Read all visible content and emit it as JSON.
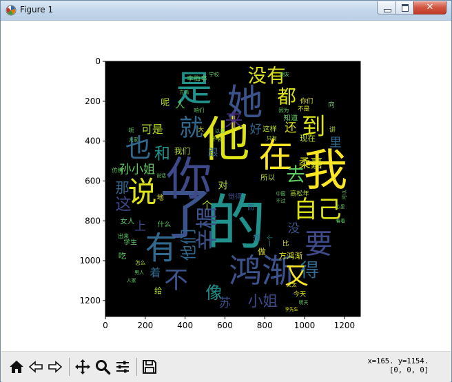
{
  "window": {
    "title": "Figure 1",
    "close_glyph": "✕"
  },
  "toolbar": {
    "items": [
      {
        "name": "home-icon"
      },
      {
        "name": "back-icon"
      },
      {
        "name": "forward-icon"
      },
      {
        "name": "pan-icon"
      },
      {
        "name": "zoom-icon"
      },
      {
        "name": "configure-subplots-icon"
      },
      {
        "name": "save-icon"
      }
    ],
    "coords_line1": "x=165. y=1154.",
    "coords_line2": "[0, 0, 0]"
  },
  "chart_data": {
    "type": "wordcloud",
    "xticks": [
      "0",
      "200",
      "400",
      "600",
      "800",
      "1000",
      "1200"
    ],
    "yticks": [
      "0",
      "200",
      "400",
      "600",
      "800",
      "1000",
      "1200"
    ],
    "xlim": [
      0,
      1280
    ],
    "ylim": [
      1280,
      0
    ],
    "words": [
      {
        "text": "的",
        "x": 655,
        "y": 815,
        "size": 300,
        "color": "#21918c",
        "rot": 0
      },
      {
        "text": "他",
        "x": 605,
        "y": 395,
        "size": 240,
        "color": "#dde318",
        "rot": 0
      },
      {
        "text": "了",
        "x": 400,
        "y": 770,
        "size": 280,
        "color": "#3b528b",
        "rot": 0
      },
      {
        "text": "你",
        "x": 420,
        "y": 590,
        "size": 230,
        "color": "#3e4989",
        "rot": 0
      },
      {
        "text": "我",
        "x": 1105,
        "y": 545,
        "size": 220,
        "color": "#fde725",
        "rot": 0
      },
      {
        "text": "在",
        "x": 855,
        "y": 470,
        "size": 170,
        "color": "#fde725",
        "rot": 0
      },
      {
        "text": "是",
        "x": 445,
        "y": 140,
        "size": 180,
        "color": "#21918c",
        "rot": 0
      },
      {
        "text": "她",
        "x": 700,
        "y": 210,
        "size": 180,
        "color": "#3b528b",
        "rot": 0
      },
      {
        "text": "鸿渐",
        "x": 785,
        "y": 1055,
        "size": 165,
        "color": "#3b528b",
        "rot": 0
      },
      {
        "text": "说",
        "x": 185,
        "y": 655,
        "size": 145,
        "color": "#dde318",
        "rot": 0
      },
      {
        "text": "有",
        "x": 280,
        "y": 935,
        "size": 160,
        "color": "#31688e",
        "rot": 0
      },
      {
        "text": "辛楣",
        "x": 510,
        "y": 840,
        "size": 110,
        "color": "#3b528b",
        "rot": -90
      },
      {
        "text": "也",
        "x": 165,
        "y": 435,
        "size": 130,
        "color": "#31688e",
        "rot": 0
      },
      {
        "text": "就",
        "x": 430,
        "y": 335,
        "size": 120,
        "color": "#31688e",
        "rot": 0
      },
      {
        "text": "自己",
        "x": 1065,
        "y": 745,
        "size": 120,
        "color": "#dde318",
        "rot": 0
      },
      {
        "text": "要",
        "x": 1070,
        "y": 915,
        "size": 140,
        "color": "#3e4989",
        "rot": 0
      },
      {
        "text": "又",
        "x": 960,
        "y": 1080,
        "size": 120,
        "color": "#fde725",
        "rot": 0
      },
      {
        "text": "没有",
        "x": 810,
        "y": 75,
        "size": 95,
        "color": "#dde318",
        "rot": 0
      },
      {
        "text": "都",
        "x": 910,
        "y": 180,
        "size": 95,
        "color": "#dde318",
        "rot": 0
      },
      {
        "text": "到",
        "x": 1045,
        "y": 330,
        "size": 120,
        "color": "#dde318",
        "rot": 0
      },
      {
        "text": "去",
        "x": 955,
        "y": 570,
        "size": 95,
        "color": "#5ec962",
        "rot": 0
      },
      {
        "text": "不",
        "x": 355,
        "y": 1100,
        "size": 120,
        "color": "#3b528b",
        "rot": 0
      },
      {
        "text": "他们",
        "x": 420,
        "y": 920,
        "size": 80,
        "color": "#31688e",
        "rot": -90
      },
      {
        "text": "小姐",
        "x": 790,
        "y": 1205,
        "size": 75,
        "color": "#3e4989",
        "rot": 0
      },
      {
        "text": "像",
        "x": 545,
        "y": 1160,
        "size": 85,
        "color": "#21918c",
        "rot": 0
      },
      {
        "text": "得",
        "x": 1025,
        "y": 1050,
        "size": 95,
        "color": "#31688e",
        "rot": 0
      },
      {
        "text": "来",
        "x": 645,
        "y": 300,
        "size": 90,
        "color": "#472c7a",
        "rot": 0
      },
      {
        "text": "和",
        "x": 285,
        "y": 465,
        "size": 80,
        "color": "#21918c",
        "rot": 0
      },
      {
        "text": "这",
        "x": 90,
        "y": 720,
        "size": 80,
        "color": "#3e4989",
        "rot": 0
      },
      {
        "text": "那",
        "x": 85,
        "y": 635,
        "size": 70,
        "color": "#31688e",
        "rot": 0
      },
      {
        "text": "孙小姐",
        "x": 160,
        "y": 545,
        "size": 60,
        "color": "#5ec962",
        "rot": 0
      },
      {
        "text": "可是",
        "x": 235,
        "y": 340,
        "size": 55,
        "color": "#b5de2b",
        "rot": 0
      },
      {
        "text": "人",
        "x": 375,
        "y": 220,
        "size": 50,
        "color": "#5ec962",
        "rot": 0
      },
      {
        "text": "柔嘉",
        "x": 1030,
        "y": 515,
        "size": 60,
        "color": "#dde318",
        "rot": 0
      },
      {
        "text": "里",
        "x": 1155,
        "y": 410,
        "size": 60,
        "color": "#31688e",
        "rot": 0
      },
      {
        "text": "还",
        "x": 930,
        "y": 335,
        "size": 60,
        "color": "#dde318",
        "rot": 0
      },
      {
        "text": "好",
        "x": 755,
        "y": 345,
        "size": 60,
        "color": "#31688e",
        "rot": 0
      },
      {
        "text": "这样",
        "x": 825,
        "y": 340,
        "size": 36,
        "color": "#b5de2b",
        "rot": 0
      },
      {
        "text": "跟",
        "x": 540,
        "y": 460,
        "size": 50,
        "color": "#31688e",
        "rot": 0
      },
      {
        "text": "对",
        "x": 590,
        "y": 625,
        "size": 50,
        "color": "#b5de2b",
        "rot": 0
      },
      {
        "text": "方鸿渐",
        "x": 930,
        "y": 975,
        "size": 40,
        "color": "#dde318",
        "rot": 0
      },
      {
        "text": "苏",
        "x": 600,
        "y": 1215,
        "size": 60,
        "color": "#3b528b",
        "rot": 0
      },
      {
        "text": "着",
        "x": 250,
        "y": 1060,
        "size": 55,
        "color": "#31688e",
        "rot": 0
      },
      {
        "text": "上",
        "x": 175,
        "y": 830,
        "size": 60,
        "color": "#3e4989",
        "rot": 0
      },
      {
        "text": "没",
        "x": 945,
        "y": 840,
        "size": 60,
        "color": "#3b528b",
        "rot": 0
      },
      {
        "text": "个",
        "x": 510,
        "y": 725,
        "size": 50,
        "color": "#b5de2b",
        "rot": 0
      },
      {
        "text": "呢",
        "x": 300,
        "y": 210,
        "size": 45,
        "color": "#b5de2b",
        "rot": 0
      },
      {
        "text": "我们",
        "x": 385,
        "y": 450,
        "size": 40,
        "color": "#b5de2b",
        "rot": 0
      },
      {
        "text": "李梅亭",
        "x": 460,
        "y": 90,
        "size": 34,
        "color": "#5ec962",
        "rot": 0
      },
      {
        "text": "女人",
        "x": 110,
        "y": 805,
        "size": 36,
        "color": "#5ec962",
        "rot": 0
      },
      {
        "text": "学生",
        "x": 125,
        "y": 910,
        "size": 34,
        "color": "#5ec962",
        "rot": 0
      },
      {
        "text": "给",
        "x": 265,
        "y": 1150,
        "size": 40,
        "color": "#b5de2b",
        "rot": 0
      },
      {
        "text": "想",
        "x": 760,
        "y": 885,
        "size": 40,
        "color": "#31688e",
        "rot": 0
      },
      {
        "text": "做",
        "x": 785,
        "y": 955,
        "size": 40,
        "color": "#dde318",
        "rot": 0
      },
      {
        "text": "所以",
        "x": 815,
        "y": 585,
        "size": 36,
        "color": "#b5de2b",
        "rot": 0
      },
      {
        "text": "觉得",
        "x": 650,
        "y": 680,
        "size": 36,
        "color": "#3e4989",
        "rot": 0
      },
      {
        "text": "现在",
        "x": 1015,
        "y": 385,
        "size": 40,
        "color": "#b5de2b",
        "rot": 0
      },
      {
        "text": "知道",
        "x": 930,
        "y": 285,
        "size": 36,
        "color": "#5ec962",
        "rot": 0
      },
      {
        "text": "你们",
        "x": 1010,
        "y": 200,
        "size": 32,
        "color": "#dde318",
        "rot": 0
      },
      {
        "text": "不是",
        "x": 995,
        "y": 240,
        "size": 30,
        "color": "#dde318",
        "rot": 0
      },
      {
        "text": "向",
        "x": 1135,
        "y": 220,
        "size": 34,
        "color": "#5ec962",
        "rot": 0
      },
      {
        "text": "讲",
        "x": 1140,
        "y": 345,
        "size": 32,
        "color": "#b5de2b",
        "rot": 0
      },
      {
        "text": "吃",
        "x": 85,
        "y": 975,
        "size": 40,
        "color": "#5ec962",
        "rot": 0
      },
      {
        "text": "什么",
        "x": 295,
        "y": 820,
        "size": 34,
        "color": "#5ec962",
        "rot": 0
      },
      {
        "text": "今天",
        "x": 975,
        "y": 1170,
        "size": 32,
        "color": "#dde318",
        "rot": 0
      },
      {
        "text": "高松年",
        "x": 975,
        "y": 665,
        "size": 32,
        "color": "#b5de2b",
        "rot": 0
      },
      {
        "text": "比",
        "x": 905,
        "y": 915,
        "size": 32,
        "color": "#dde318",
        "rot": 0
      },
      {
        "text": "而",
        "x": 730,
        "y": 735,
        "size": 34,
        "color": "#31688e",
        "rot": 0
      },
      {
        "text": "一个",
        "x": 830,
        "y": 900,
        "size": 30,
        "color": "#21918c",
        "rot": -90
      },
      {
        "text": "大",
        "x": 480,
        "y": 345,
        "size": 30,
        "color": "#dde318",
        "rot": 0
      },
      {
        "text": "不会",
        "x": 560,
        "y": 390,
        "size": 28,
        "color": "#b5de2b",
        "rot": 0
      },
      {
        "text": "咱们",
        "x": 470,
        "y": 245,
        "size": 26,
        "color": "#5ec962",
        "rot": 0
      },
      {
        "text": "以后",
        "x": 575,
        "y": 350,
        "size": 26,
        "color": "#5ec962",
        "rot": 0
      },
      {
        "text": "只有",
        "x": 835,
        "y": 385,
        "size": 26,
        "color": "#b5de2b",
        "rot": 0
      },
      {
        "text": "出来",
        "x": 90,
        "y": 875,
        "size": 28,
        "color": "#5ec962",
        "rot": 0
      },
      {
        "text": "地",
        "x": 275,
        "y": 685,
        "size": 36,
        "color": "#dde318",
        "rot": 0
      },
      {
        "text": "仿佛",
        "x": 60,
        "y": 545,
        "size": 28,
        "color": "#5ec962",
        "rot": 0
      },
      {
        "text": "听",
        "x": 130,
        "y": 350,
        "size": 30,
        "color": "#5ec962",
        "rot": 0
      },
      {
        "text": "学校",
        "x": 545,
        "y": 65,
        "size": 26,
        "color": "#5ec962",
        "rot": 0
      },
      {
        "text": "朋友",
        "x": 900,
        "y": 65,
        "size": 24,
        "color": "#5ec962",
        "rot": 0
      },
      {
        "text": "因为",
        "x": 895,
        "y": 245,
        "size": 26,
        "color": "#5ec962",
        "rot": 0
      },
      {
        "text": "怎么",
        "x": 175,
        "y": 1010,
        "size": 26,
        "color": "#b5de2b",
        "rot": 0
      },
      {
        "text": "大家",
        "x": 140,
        "y": 395,
        "size": 24,
        "color": "#5ec962",
        "rot": 0
      },
      {
        "text": "方鸿",
        "x": 395,
        "y": 155,
        "size": 24,
        "color": "#5ec962",
        "rot": 0
      },
      {
        "text": "说话",
        "x": 280,
        "y": 575,
        "size": 24,
        "color": "#5ec962",
        "rot": 0
      },
      {
        "text": "太太",
        "x": 935,
        "y": 1120,
        "size": 26,
        "color": "#dde318",
        "rot": 0
      },
      {
        "text": "李先生",
        "x": 935,
        "y": 1245,
        "size": 22,
        "color": "#dde318",
        "rot": 0
      },
      {
        "text": "明天",
        "x": 995,
        "y": 1210,
        "size": 24,
        "color": "#5ec962",
        "rot": 0
      },
      {
        "text": "中国",
        "x": 880,
        "y": 665,
        "size": 24,
        "color": "#5ec962",
        "rot": 0
      },
      {
        "text": "不过",
        "x": 880,
        "y": 700,
        "size": 24,
        "color": "#5ec962",
        "rot": 0
      },
      {
        "text": "人家",
        "x": 130,
        "y": 1100,
        "size": 24,
        "color": "#5ec962",
        "rot": 0
      },
      {
        "text": "男人",
        "x": 170,
        "y": 1060,
        "size": 24,
        "color": "#5ec962",
        "rot": 0
      },
      {
        "text": "可以",
        "x": 1200,
        "y": 670,
        "size": 24,
        "color": "#5ec962",
        "rot": -90
      },
      {
        "text": "心里",
        "x": 1180,
        "y": 730,
        "size": 22,
        "color": "#5ec962",
        "rot": 0
      },
      {
        "text": "看着",
        "x": 1180,
        "y": 800,
        "size": 24,
        "color": "#5ec962",
        "rot": 0
      }
    ]
  }
}
